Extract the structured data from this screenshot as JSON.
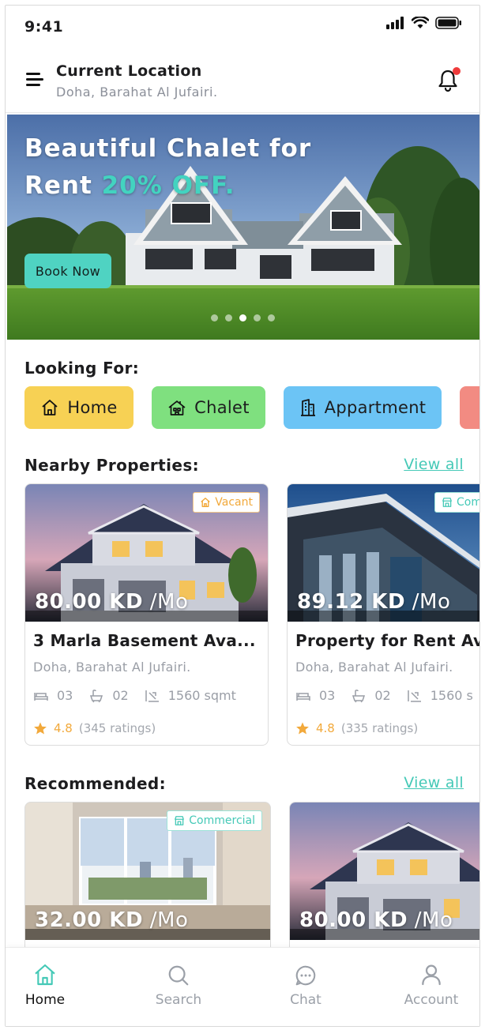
{
  "status_bar": {
    "time": "9:41"
  },
  "header": {
    "location_title": "Current Location",
    "location_value": "Doha, Barahat Al Jufairi."
  },
  "hero": {
    "title_line1": "Beautiful Chalet for",
    "title_line2_prefix": "Rent ",
    "title_line2_accent": "20% OFF.",
    "button": "Book Now",
    "dot_count": 5,
    "active_dot": 3
  },
  "looking_for": {
    "title": "Looking For:",
    "items": [
      {
        "label": "Home",
        "icon": "home-icon",
        "color": "#f7d154"
      },
      {
        "label": "Chalet",
        "icon": "chalet-icon",
        "color": "#7fe07f"
      },
      {
        "label": "Appartment",
        "icon": "building-icon",
        "color": "#6cc4f5"
      },
      {
        "label": "",
        "icon": "",
        "color": "#f28b82"
      }
    ]
  },
  "nearby": {
    "title": "Nearby Properties:",
    "view_all": "View all",
    "cards": [
      {
        "badge": "Vacant",
        "badge_icon": "home-icon",
        "badge_color": "#f2a93b",
        "price": "80.00 KD",
        "unit": " /Mo",
        "title": "3 Marla Basement Ava...",
        "location": "Doha, Barahat Al Jufairi.",
        "beds": "03",
        "baths": "02",
        "area": "1560 sqmt",
        "rating": "4.8",
        "ratings_count": "(345 ratings)"
      },
      {
        "badge": "Com",
        "badge_icon": "shop-icon",
        "badge_color": "#45c9b7",
        "price": "89.12 KD",
        "unit": " /Mo",
        "title": "Property for Rent Ava",
        "location": "Doha, Barahat Al Jufairi.",
        "beds": "03",
        "baths": "02",
        "area": "1560 s",
        "rating": "4.8",
        "ratings_count": "(335 ratings)"
      }
    ]
  },
  "recommended": {
    "title": "Recommended:",
    "view_all": "View all",
    "cards": [
      {
        "badge": "Commercial",
        "badge_icon": "shop-icon",
        "badge_color": "#45c9b7",
        "price": "32.00 KD",
        "unit": " /Mo"
      },
      {
        "badge": "",
        "price": "80.00 KD",
        "unit": " /Mo"
      }
    ]
  },
  "bottom_nav": {
    "items": [
      {
        "label": "Home",
        "icon": "home-icon",
        "active": true
      },
      {
        "label": "Search",
        "icon": "search-icon",
        "active": false
      },
      {
        "label": "Chat",
        "icon": "chat-icon",
        "active": false
      },
      {
        "label": "Account",
        "icon": "account-icon",
        "active": false
      }
    ]
  },
  "colors": {
    "accent": "#45c9b7",
    "notification": "#ef3b3b",
    "star": "#f2a93b"
  }
}
